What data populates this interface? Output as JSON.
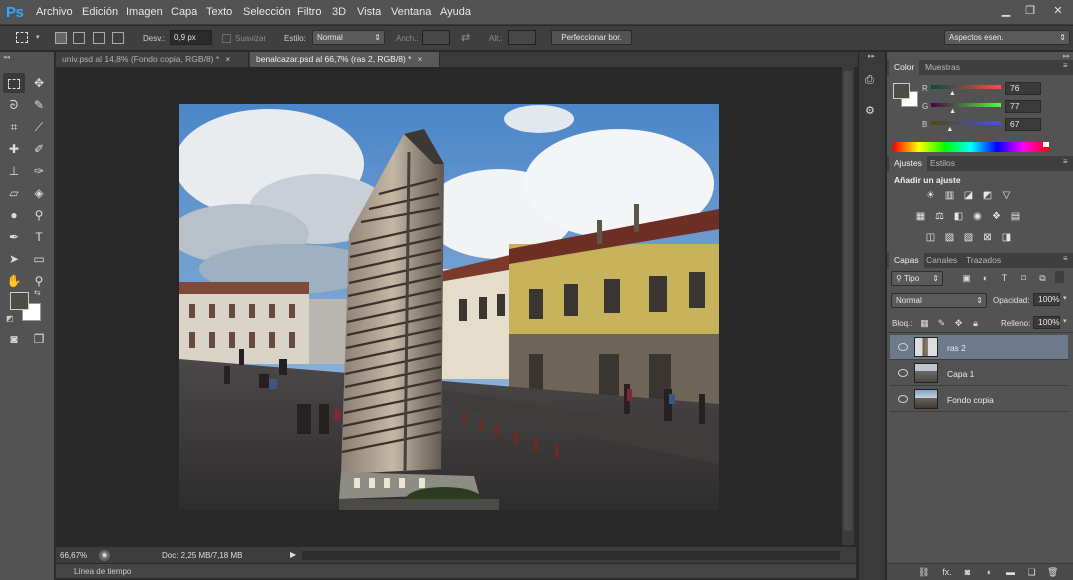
{
  "app": {
    "logo": "Ps"
  },
  "menu": [
    "Archivo",
    "Edición",
    "Imagen",
    "Capa",
    "Texto",
    "Selección",
    "Filtro",
    "3D",
    "Vista",
    "Ventana",
    "Ayuda"
  ],
  "window_controls": {
    "minimize": "▁",
    "restore": "❐",
    "close": "✕"
  },
  "options": {
    "feather_label": "Desv.:",
    "feather_value": "0,9 px",
    "antialias_label": "Suavizar",
    "style_label": "Estilo:",
    "style_value": "Normal",
    "width_label": "Anch.:",
    "height_label": "Alt.:",
    "refine_button": "Perfeccionar bor.",
    "workspace": "Aspectos esen."
  },
  "tabs": [
    {
      "label": "univ.psd al 14,8% (Fondo copia, RGB/8) *",
      "close": "×"
    },
    {
      "label": "benalcazar.psd al 66,7% (ras 2, RGB/8) *",
      "close": "×"
    }
  ],
  "status": {
    "zoom": "66,67%",
    "doc": "Doc: 2,25 MB/7,18 MB"
  },
  "timeline": {
    "label": "Línea de tiempo"
  },
  "color_panel": {
    "tabs": [
      "Color",
      "Muestras"
    ],
    "channels": [
      {
        "label": "R",
        "value": "76",
        "fraction": 0.298
      },
      {
        "label": "G",
        "value": "77",
        "fraction": 0.302
      },
      {
        "label": "B",
        "value": "67",
        "fraction": 0.263
      }
    ],
    "foreground": "#4c4d43",
    "background": "#ffffff"
  },
  "adjust_panel": {
    "tabs": [
      "Ajustes",
      "Estilos"
    ],
    "title": "Añadir un ajuste"
  },
  "layers_panel": {
    "tabs": [
      "Capas",
      "Canales",
      "Trazados"
    ],
    "filter": "Tipo",
    "blend_mode": "Normal",
    "opacity_label": "Opacidad:",
    "opacity_value": "100%",
    "lock_label": "Bloq.:",
    "fill_label": "Relleno:",
    "fill_value": "100%",
    "layers": [
      {
        "name": "ras 2",
        "selected": true
      },
      {
        "name": "Capa 1",
        "selected": false
      },
      {
        "name": "Fondo copia",
        "selected": false
      }
    ],
    "footer_icons": [
      "link-icon",
      "fx-icon",
      "mask-icon",
      "adjustment-icon",
      "group-icon",
      "new-layer-icon",
      "trash-icon"
    ]
  },
  "colors": {
    "accent": "#31a8ff",
    "selection": "#6d7a8c"
  }
}
